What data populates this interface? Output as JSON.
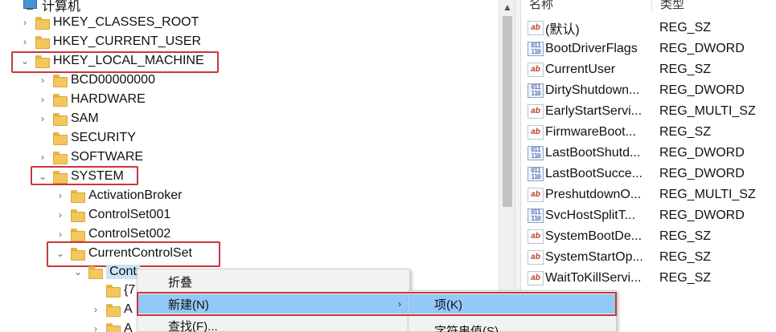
{
  "tree": {
    "root": "计算机",
    "items": [
      {
        "label": "HKEY_CLASSES_ROOT",
        "chevron": "›"
      },
      {
        "label": "HKEY_CURRENT_USER",
        "chevron": "›"
      },
      {
        "label": "HKEY_LOCAL_MACHINE",
        "chevron": "⌄"
      },
      {
        "label": "BCD00000000",
        "chevron": "›"
      },
      {
        "label": "HARDWARE",
        "chevron": "›"
      },
      {
        "label": "SAM",
        "chevron": "›"
      },
      {
        "label": "SECURITY",
        "chevron": ""
      },
      {
        "label": "SOFTWARE",
        "chevron": "›"
      },
      {
        "label": "SYSTEM",
        "chevron": "⌄"
      },
      {
        "label": "ActivationBroker",
        "chevron": "›"
      },
      {
        "label": "ControlSet001",
        "chevron": "›"
      },
      {
        "label": "ControlSet002",
        "chevron": "›"
      },
      {
        "label": "CurrentControlSet",
        "chevron": "⌄"
      },
      {
        "label": "Cont",
        "chevron": "⌄"
      },
      {
        "label": "{7",
        "chevron": ""
      },
      {
        "label": "A",
        "chevron": "›"
      },
      {
        "label": "A",
        "chevron": "›"
      }
    ]
  },
  "list": {
    "col_name": "名称",
    "col_type": "类型",
    "rows": [
      {
        "name": "(默认)",
        "type": "REG_SZ",
        "icon": "ab"
      },
      {
        "name": "BootDriverFlags",
        "type": "REG_DWORD",
        "icon": "bin"
      },
      {
        "name": "CurrentUser",
        "type": "REG_SZ",
        "icon": "ab"
      },
      {
        "name": "DirtyShutdown...",
        "type": "REG_DWORD",
        "icon": "bin"
      },
      {
        "name": "EarlyStartServi...",
        "type": "REG_MULTI_SZ",
        "icon": "ab"
      },
      {
        "name": "FirmwareBoot...",
        "type": "REG_SZ",
        "icon": "ab"
      },
      {
        "name": "LastBootShutd...",
        "type": "REG_DWORD",
        "icon": "bin"
      },
      {
        "name": "LastBootSucce...",
        "type": "REG_DWORD",
        "icon": "bin"
      },
      {
        "name": "PreshutdownO...",
        "type": "REG_MULTI_SZ",
        "icon": "ab"
      },
      {
        "name": "SvcHostSplitT...",
        "type": "REG_DWORD",
        "icon": "bin"
      },
      {
        "name": "SystemBootDe...",
        "type": "REG_SZ",
        "icon": "ab"
      },
      {
        "name": "SystemStartOp...",
        "type": "REG_SZ",
        "icon": "ab"
      },
      {
        "name": "WaitToKillServi...",
        "type": "REG_SZ",
        "icon": "ab"
      }
    ]
  },
  "context_menu": {
    "collapse": "折叠",
    "new": "新建(N)",
    "find": "查找(F)...",
    "submenu_arrow": "›"
  },
  "submenu": {
    "key": "项(K)",
    "string_value": "字符串值(S)"
  },
  "icons": {
    "ab": "ab",
    "bin": "011\n110",
    "scroll_up": "▲"
  },
  "colors": {
    "highlight_box": "#c9363b",
    "menu_hover": "#91c9f7",
    "folder": "#f2c75c"
  }
}
